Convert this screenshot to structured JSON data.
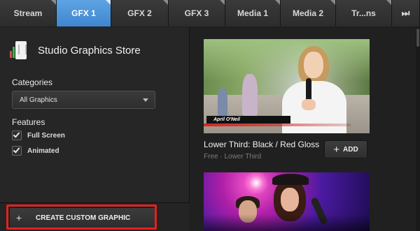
{
  "tabs": [
    {
      "label": "Stream",
      "active": false
    },
    {
      "label": "GFX 1",
      "active": true
    },
    {
      "label": "GFX 2",
      "active": false
    },
    {
      "label": "GFX 3",
      "active": false
    },
    {
      "label": "Media 1",
      "active": false
    },
    {
      "label": "Media 2",
      "active": false
    },
    {
      "label": "Tr...ns",
      "active": false
    }
  ],
  "more_tabs_glyph": "⏭",
  "store": {
    "title": "Studio Graphics Store",
    "logo_icon": "store-logo-icon"
  },
  "categories": {
    "label": "Categories",
    "selected": "All Graphics"
  },
  "features": {
    "label": "Features",
    "items": [
      {
        "label": "Full Screen",
        "checked": true
      },
      {
        "label": "Animated",
        "checked": true
      }
    ]
  },
  "create_button": {
    "plus": "+",
    "label": "CREATE CUSTOM GRAPHIC"
  },
  "cards": [
    {
      "title": "Lower Third: Black / Red Gloss",
      "subtitle": "Free · Lower Third",
      "lower_third_name": "April O'Neil",
      "add_plus": "+",
      "add_label": "ADD"
    }
  ],
  "colors": {
    "active_tab": "#4a93d9",
    "highlight": "#e8201c",
    "background": "#1e1e1e"
  }
}
